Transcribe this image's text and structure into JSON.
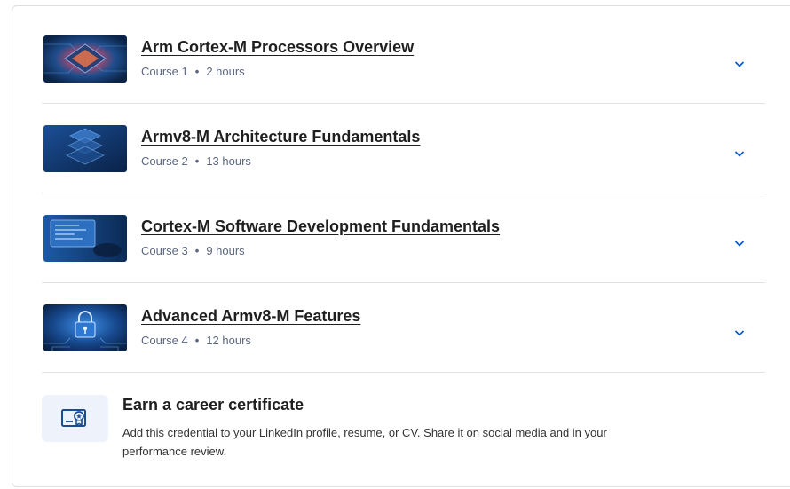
{
  "courses": [
    {
      "title": "Arm Cortex-M Processors Overview",
      "course_label": "Course 1",
      "duration": "2 hours",
      "thumbnail": "chip-glow-image"
    },
    {
      "title": "Armv8-M Architecture Fundamentals",
      "course_label": "Course 2",
      "duration": "13 hours",
      "thumbnail": "layered-stack-image"
    },
    {
      "title": "Cortex-M Software Development Fundamentals",
      "course_label": "Course 3",
      "duration": "9 hours",
      "thumbnail": "laptop-code-image"
    },
    {
      "title": "Advanced Armv8-M Features",
      "course_label": "Course 4",
      "duration": "12 hours",
      "thumbnail": "padlock-circuit-image"
    }
  ],
  "separator": "•",
  "expand_icon": "chevron-down-icon",
  "certificate": {
    "icon": "certificate-icon",
    "title": "Earn a career certificate",
    "description": "Add this credential to your LinkedIn profile, resume, or CV. Share it on social media and in your performance review."
  },
  "colors": {
    "accent": "#0056d2",
    "title_text": "#1f1f1f",
    "meta_text": "#5b6780",
    "divider": "#e1e3e6",
    "cert_icon_bg": "#eef3fb"
  }
}
